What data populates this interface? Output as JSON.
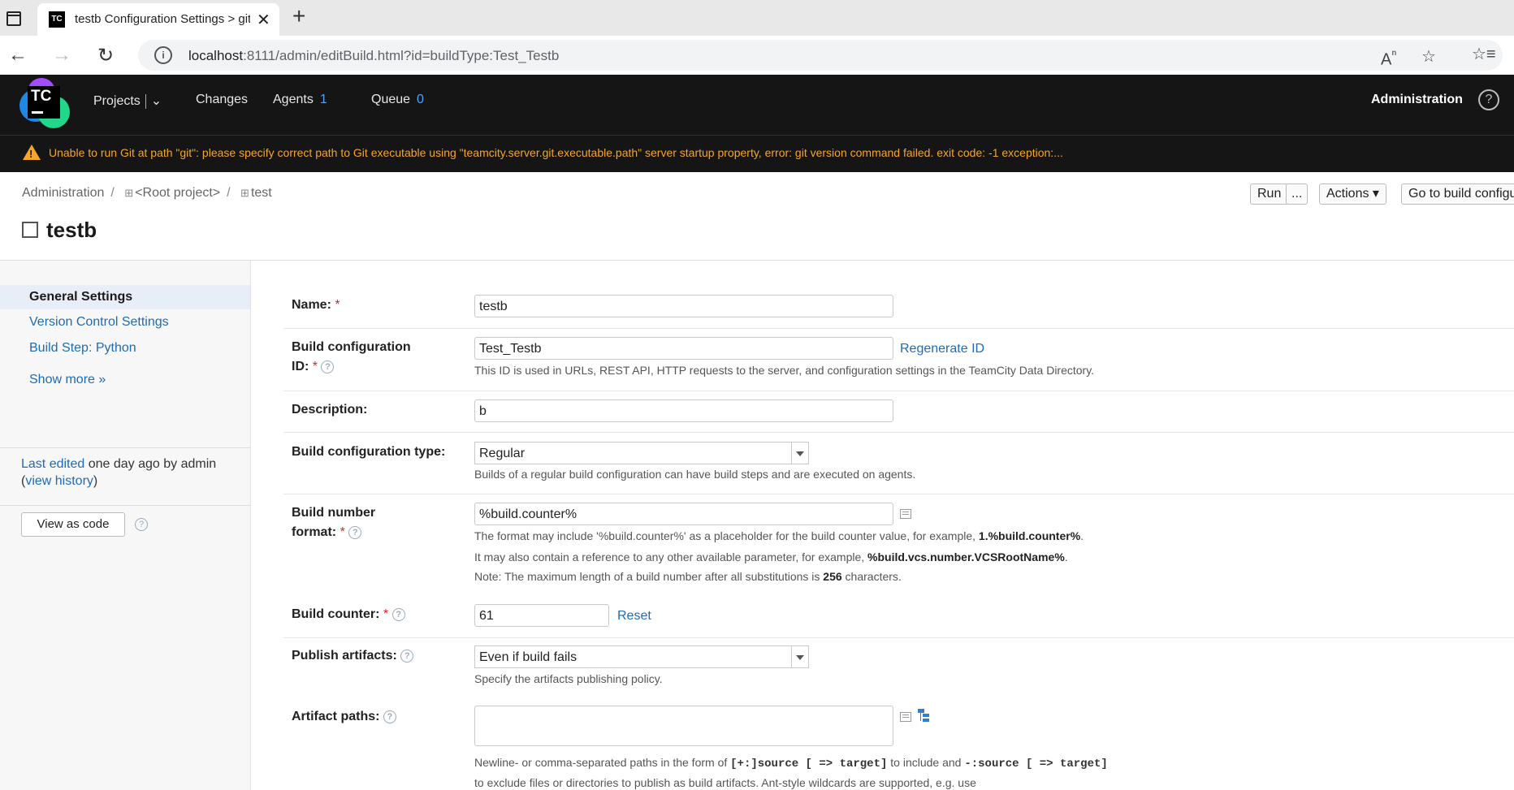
{
  "browser": {
    "tab_title": "testb Configuration Settings > git",
    "tab_favicon": "TC",
    "url_host": "localhost",
    "url_rest": ":8111/admin/editBuild.html?id=buildType:Test_Testb"
  },
  "header": {
    "nav": [
      {
        "label": "Projects"
      },
      {
        "label": "Changes"
      },
      {
        "label": "Agents",
        "count": "1"
      },
      {
        "label": "Queue",
        "count": "0"
      }
    ],
    "admin_label": "Administration",
    "warning": "Unable to run Git at path \"git\": please specify correct path to Git executable using \"teamcity.server.git.executable.path\" server startup property, error: git version command failed. exit code: -1 exception:...",
    "colors": {
      "background": "#151515",
      "warning": "#f5a623",
      "count": "#4da3ff"
    }
  },
  "breadcrumb": {
    "items": [
      "Administration",
      "<Root project>",
      "test"
    ]
  },
  "page": {
    "title": "testb",
    "buttons": {
      "run": "Run",
      "more": "...",
      "actions": "Actions",
      "goto": "Go to build configuration page"
    }
  },
  "sidebar": {
    "items": [
      "General Settings",
      "Version Control Settings",
      "Build Step: Python"
    ],
    "show_more": "Show more »",
    "last_edited_link": "Last edited",
    "last_edited_text": " one day ago by admin",
    "view_history": "view history",
    "view_as_code": "View as code"
  },
  "form": {
    "name_label": "Name:",
    "name_value": "testb",
    "id_label_1": "Build configuration",
    "id_label_2": "ID:",
    "id_value": "Test_Testb",
    "regenerate": "Regenerate ID",
    "id_hint": "This ID is used in URLs, REST API, HTTP requests to the server, and configuration settings in the TeamCity Data Directory.",
    "desc_label": "Description:",
    "desc_value": "b",
    "type_label": "Build configuration type:",
    "type_value": "Regular",
    "type_hint": "Builds of a regular build configuration can have build steps and are executed on agents.",
    "bn_label_1": "Build number",
    "bn_label_2": "format:",
    "bn_value": "%build.counter%",
    "bn_hint1_pre": "The format may include '%build.counter%' as a placeholder for the build counter value, for example, ",
    "bn_hint1_b": "1.%build.counter%",
    "bn_hint2_pre": "It may also contain a reference to any other available parameter, for example, ",
    "bn_hint2_b": "%build.vcs.number.VCSRootName%",
    "bn_hint3_pre": "Note: The maximum length of a build number after all substitutions is ",
    "bn_hint3_b": "256",
    "bn_hint3_post": " characters.",
    "counter_label": "Build counter:",
    "counter_value": "61",
    "reset": "Reset",
    "publish_label": "Publish artifacts:",
    "publish_value": "Even if build fails",
    "publish_hint": "Specify the artifacts publishing policy.",
    "artifact_label": "Artifact paths:",
    "artifact_value": "",
    "art_hint1_pre": "Newline- or comma-separated paths in the form of ",
    "art_hint1_code1": "[+:]source [ => target]",
    "art_hint1_mid": " to include and ",
    "art_hint1_code2": "-:source [ => target]",
    "art_hint2": "to exclude files or directories to publish as build artifacts. Ant-style wildcards are supported, e.g. use"
  }
}
